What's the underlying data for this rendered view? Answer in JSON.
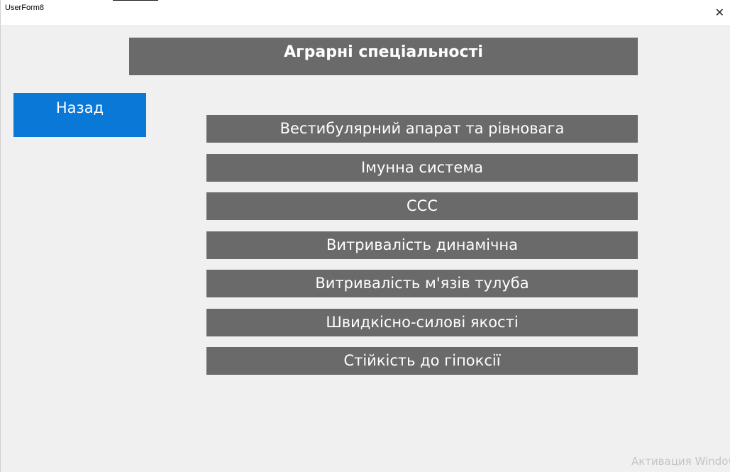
{
  "window": {
    "title": "UserForm8",
    "close_glyph": "✕",
    "close_icon": "close-icon"
  },
  "header": {
    "title": "Аграрні спеціальності"
  },
  "back_button": {
    "label": "Назад",
    "color": "#0a78d7"
  },
  "menu": {
    "button_color": "#6a6a6a",
    "items": [
      {
        "label": "Вестибулярний апарат та рівновага"
      },
      {
        "label": "Імунна система"
      },
      {
        "label": "ССС"
      },
      {
        "label": "Витривалість динамічна"
      },
      {
        "label": "Витривалість  м'язів тулуба"
      },
      {
        "label": "Швидкісно-силові якості"
      },
      {
        "label": "Стійкість до гіпоксії"
      }
    ]
  },
  "watermark": {
    "text": "Активация Windows"
  }
}
